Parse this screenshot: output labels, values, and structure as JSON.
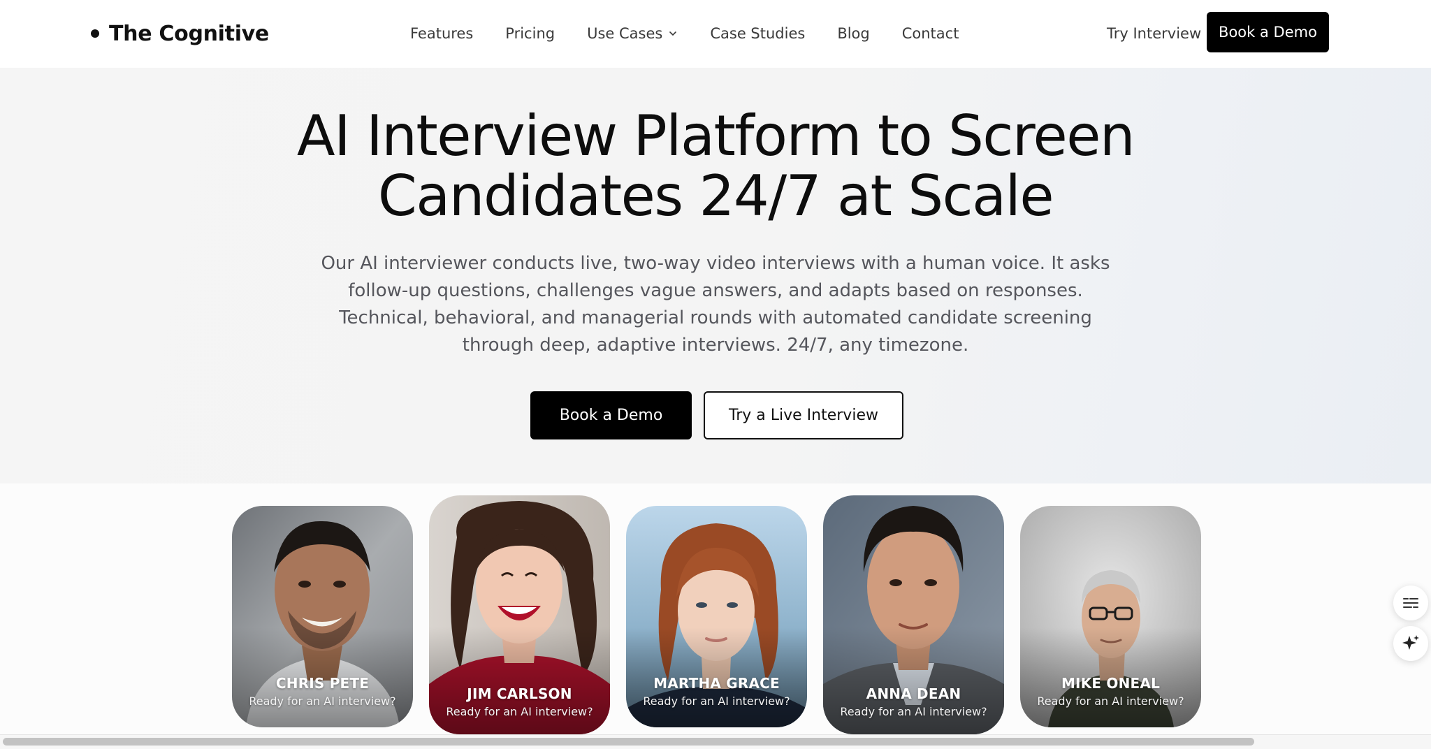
{
  "brand": {
    "name": "The Cognitive"
  },
  "nav": {
    "items": [
      {
        "label": "Features"
      },
      {
        "label": "Pricing"
      },
      {
        "label": "Use Cases"
      },
      {
        "label": "Case Studies"
      },
      {
        "label": "Blog"
      },
      {
        "label": "Contact"
      }
    ],
    "try_label": "Try Interview",
    "demo_label": "Book a Demo"
  },
  "hero": {
    "title_line1": "AI Interview Platform to Screen",
    "title_line2": "Candidates 24/7 at Scale",
    "subtitle": "Our AI interviewer conducts live, two-way video interviews with a human voice. It asks follow-up questions, challenges vague answers, and adapts based on responses. Technical, behavioral, and managerial rounds with automated candidate screening through deep, adaptive interviews. 24/7, any timezone.",
    "primary_cta": "Book a Demo",
    "secondary_cta": "Try a Live Interview"
  },
  "interviewers": [
    {
      "name": "CHRIS PETE",
      "caption": "Ready for an AI interview?"
    },
    {
      "name": "JIM CARLSON",
      "caption": "Ready for an AI interview?"
    },
    {
      "name": "MARTHA GRACE",
      "caption": "Ready for an AI interview?"
    },
    {
      "name": "ANNA DEAN",
      "caption": "Ready for an AI interview?"
    },
    {
      "name": "MIKE ONEAL",
      "caption": "Ready for an AI interview?"
    }
  ],
  "widgets": [
    "captions-icon",
    "sparkle-icon"
  ],
  "colors": {
    "primary": "#000000",
    "hero_bg": "#f5f5f5",
    "text_muted": "#55565c"
  }
}
